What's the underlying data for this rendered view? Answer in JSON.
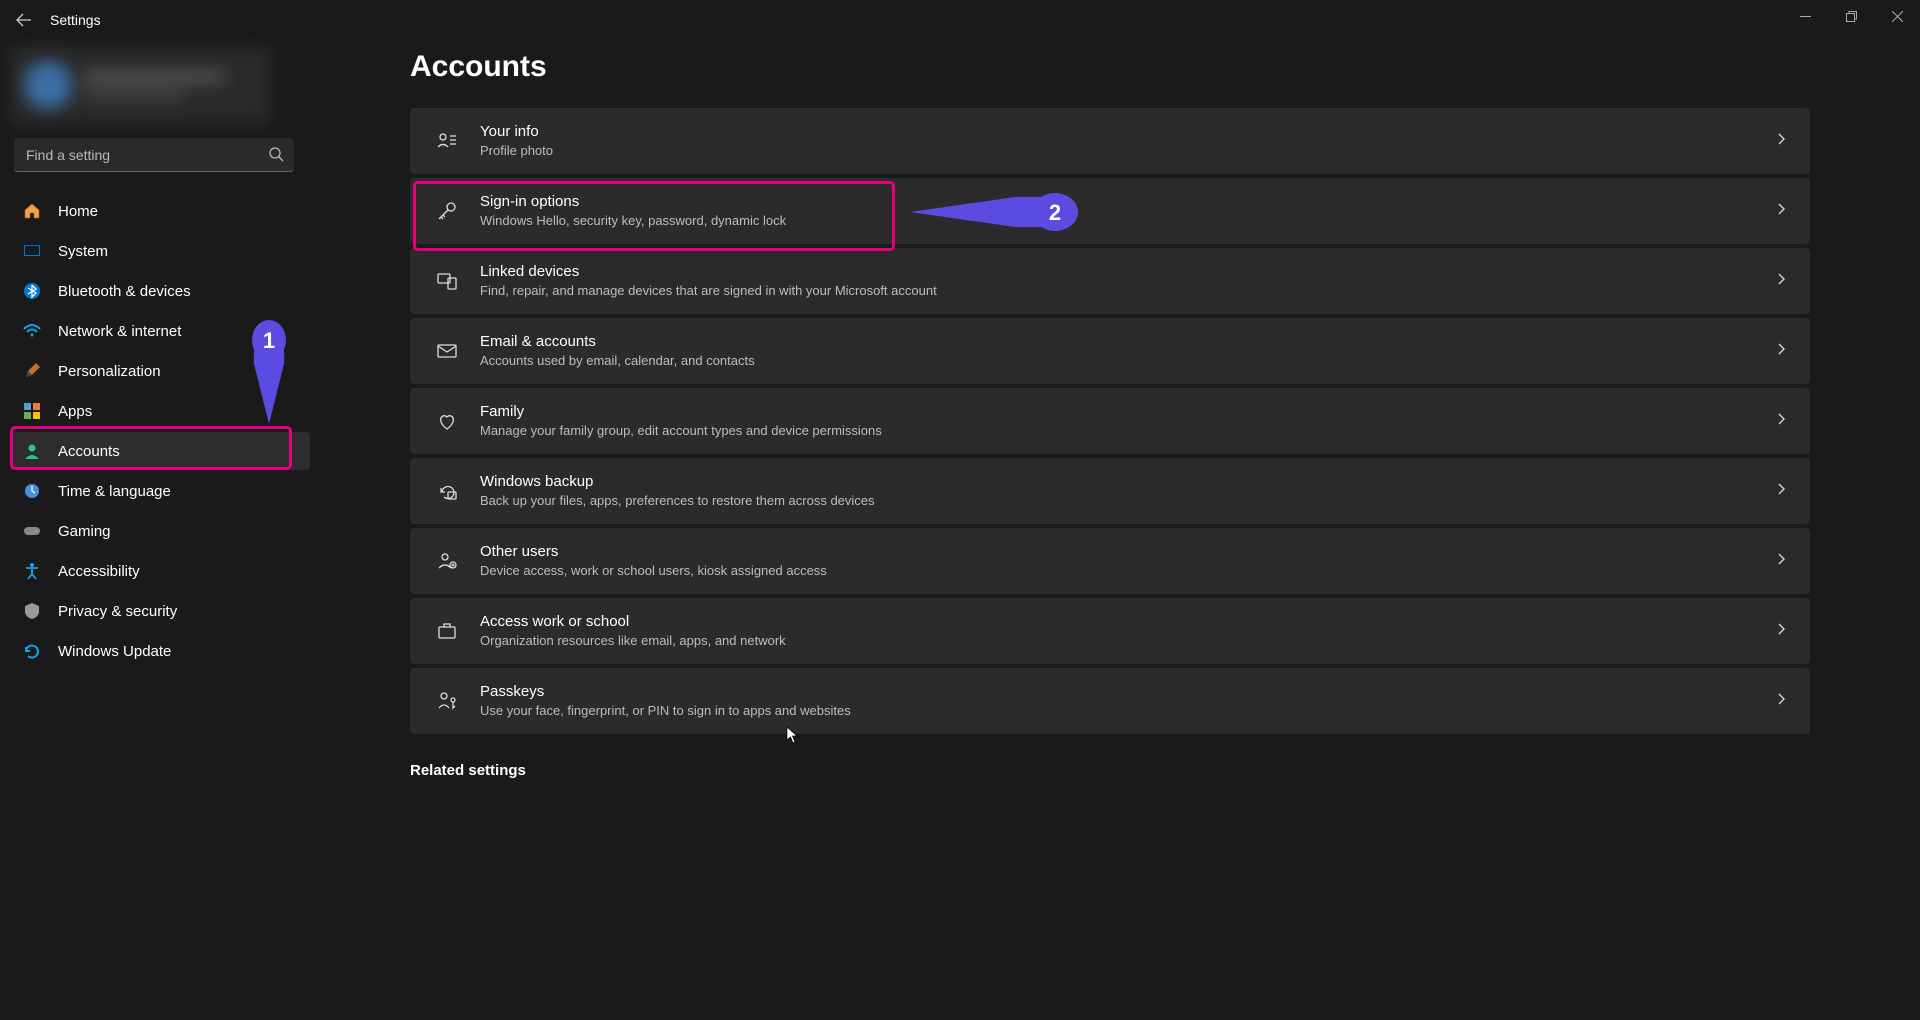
{
  "titlebar": {
    "title": "Settings"
  },
  "search": {
    "placeholder": "Find a setting"
  },
  "nav": {
    "items": [
      {
        "label": "Home"
      },
      {
        "label": "System"
      },
      {
        "label": "Bluetooth & devices"
      },
      {
        "label": "Network & internet"
      },
      {
        "label": "Personalization"
      },
      {
        "label": "Apps"
      },
      {
        "label": "Accounts"
      },
      {
        "label": "Time & language"
      },
      {
        "label": "Gaming"
      },
      {
        "label": "Accessibility"
      },
      {
        "label": "Privacy & security"
      },
      {
        "label": "Windows Update"
      }
    ]
  },
  "page": {
    "title": "Accounts",
    "rows": [
      {
        "title": "Your info",
        "sub": "Profile photo"
      },
      {
        "title": "Sign-in options",
        "sub": "Windows Hello, security key, password, dynamic lock"
      },
      {
        "title": "Linked devices",
        "sub": "Find, repair, and manage devices that are signed in with your Microsoft account"
      },
      {
        "title": "Email & accounts",
        "sub": "Accounts used by email, calendar, and contacts"
      },
      {
        "title": "Family",
        "sub": "Manage your family group, edit account types and device permissions"
      },
      {
        "title": "Windows backup",
        "sub": "Back up your files, apps, preferences to restore them across devices"
      },
      {
        "title": "Other users",
        "sub": "Device access, work or school users, kiosk assigned access"
      },
      {
        "title": "Access work or school",
        "sub": "Organization resources like email, apps, and network"
      },
      {
        "title": "Passkeys",
        "sub": "Use your face, fingerprint, or PIN to sign in to apps and websites"
      }
    ],
    "related_header": "Related settings"
  },
  "annotations": {
    "marker1": "1",
    "marker2": "2"
  }
}
